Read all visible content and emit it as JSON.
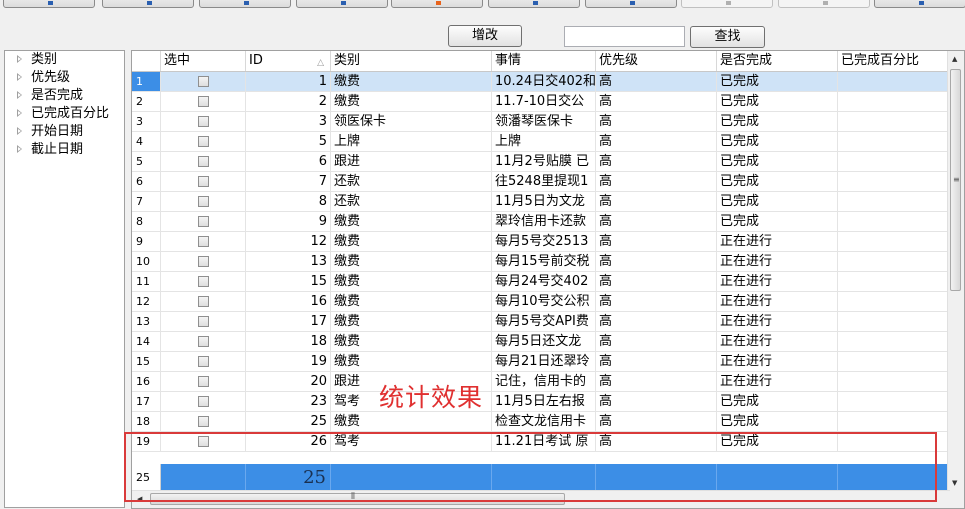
{
  "toolbar": {
    "buttons": [
      {
        "icon": "first-record-icon",
        "style": "blue"
      },
      {
        "icon": "previous-record-icon",
        "style": "blue"
      },
      {
        "icon": "next-record-icon",
        "style": "blue"
      },
      {
        "icon": "last-record-icon",
        "style": "blue"
      },
      {
        "icon": "insert-record-icon",
        "style": "orange"
      },
      {
        "icon": "delete-record-icon",
        "style": "blue"
      },
      {
        "icon": "edit-record-icon",
        "style": "blue"
      },
      {
        "icon": "undo-icon",
        "style": "light"
      },
      {
        "icon": "save-icon",
        "style": "light"
      },
      {
        "icon": "refresh-icon",
        "style": "blue"
      }
    ],
    "edit_label": "增改",
    "search_label": "查找",
    "search_value": ""
  },
  "tree": {
    "items": [
      "类别",
      "优先级",
      "是否完成",
      "已完成百分比",
      "开始日期",
      "截止日期"
    ]
  },
  "grid": {
    "columns": [
      "选中",
      "ID",
      "类别",
      "事情",
      "优先级",
      "是否完成",
      "已完成百分比"
    ],
    "rows": [
      {
        "num": "1",
        "id": "1",
        "category": "缴费",
        "task": "10.24日交402和",
        "priority": "高",
        "status": "已完成",
        "percent": ""
      },
      {
        "num": "2",
        "id": "2",
        "category": "缴费",
        "task": "11.7-10日交公",
        "priority": "高",
        "status": "已完成",
        "percent": ""
      },
      {
        "num": "3",
        "id": "3",
        "category": "领医保卡",
        "task": "领潘琴医保卡",
        "priority": "高",
        "status": "已完成",
        "percent": ""
      },
      {
        "num": "4",
        "id": "5",
        "category": "上牌",
        "task": "上牌",
        "priority": "高",
        "status": "已完成",
        "percent": ""
      },
      {
        "num": "5",
        "id": "6",
        "category": "跟进",
        "task": "11月2号贴膜 已",
        "priority": "高",
        "status": "已完成",
        "percent": ""
      },
      {
        "num": "6",
        "id": "7",
        "category": "还款",
        "task": "往5248里提现1",
        "priority": "高",
        "status": "已完成",
        "percent": ""
      },
      {
        "num": "7",
        "id": "8",
        "category": "还款",
        "task": "11月5日为文龙",
        "priority": "高",
        "status": "已完成",
        "percent": ""
      },
      {
        "num": "8",
        "id": "9",
        "category": "缴费",
        "task": "翠玲信用卡还款",
        "priority": "高",
        "status": "已完成",
        "percent": ""
      },
      {
        "num": "9",
        "id": "12",
        "category": "缴费",
        "task": "每月5号交2513",
        "priority": "高",
        "status": "正在进行",
        "percent": ""
      },
      {
        "num": "10",
        "id": "13",
        "category": "缴费",
        "task": "每月15号前交税",
        "priority": "高",
        "status": "正在进行",
        "percent": ""
      },
      {
        "num": "11",
        "id": "15",
        "category": "缴费",
        "task": "每月24号交402",
        "priority": "高",
        "status": "正在进行",
        "percent": ""
      },
      {
        "num": "12",
        "id": "16",
        "category": "缴费",
        "task": "每月10号交公积",
        "priority": "高",
        "status": "正在进行",
        "percent": ""
      },
      {
        "num": "13",
        "id": "17",
        "category": "缴费",
        "task": "每月5号交API费",
        "priority": "高",
        "status": "正在进行",
        "percent": ""
      },
      {
        "num": "14",
        "id": "18",
        "category": "缴费",
        "task": "每月5日还文龙",
        "priority": "高",
        "status": "正在进行",
        "percent": ""
      },
      {
        "num": "15",
        "id": "19",
        "category": "缴费",
        "task": "每月21日还翠玲",
        "priority": "高",
        "status": "正在进行",
        "percent": ""
      },
      {
        "num": "16",
        "id": "20",
        "category": "跟进",
        "task": "记住，信用卡的",
        "priority": "高",
        "status": "正在进行",
        "percent": ""
      },
      {
        "num": "17",
        "id": "23",
        "category": "驾考",
        "task": "11月5日左右报",
        "priority": "高",
        "status": "已完成",
        "percent": ""
      },
      {
        "num": "18",
        "id": "25",
        "category": "缴费",
        "task": "检查文龙信用卡",
        "priority": "高",
        "status": "已完成",
        "percent": ""
      },
      {
        "num": "19",
        "id": "26",
        "category": "驾考",
        "task": "11.21日考试 原",
        "priority": "高",
        "status": "已完成",
        "percent": ""
      }
    ],
    "footer": {
      "row_count": "25",
      "id_count": "25"
    }
  },
  "annotation": {
    "text": "统计效果",
    "color": "#e03030"
  }
}
